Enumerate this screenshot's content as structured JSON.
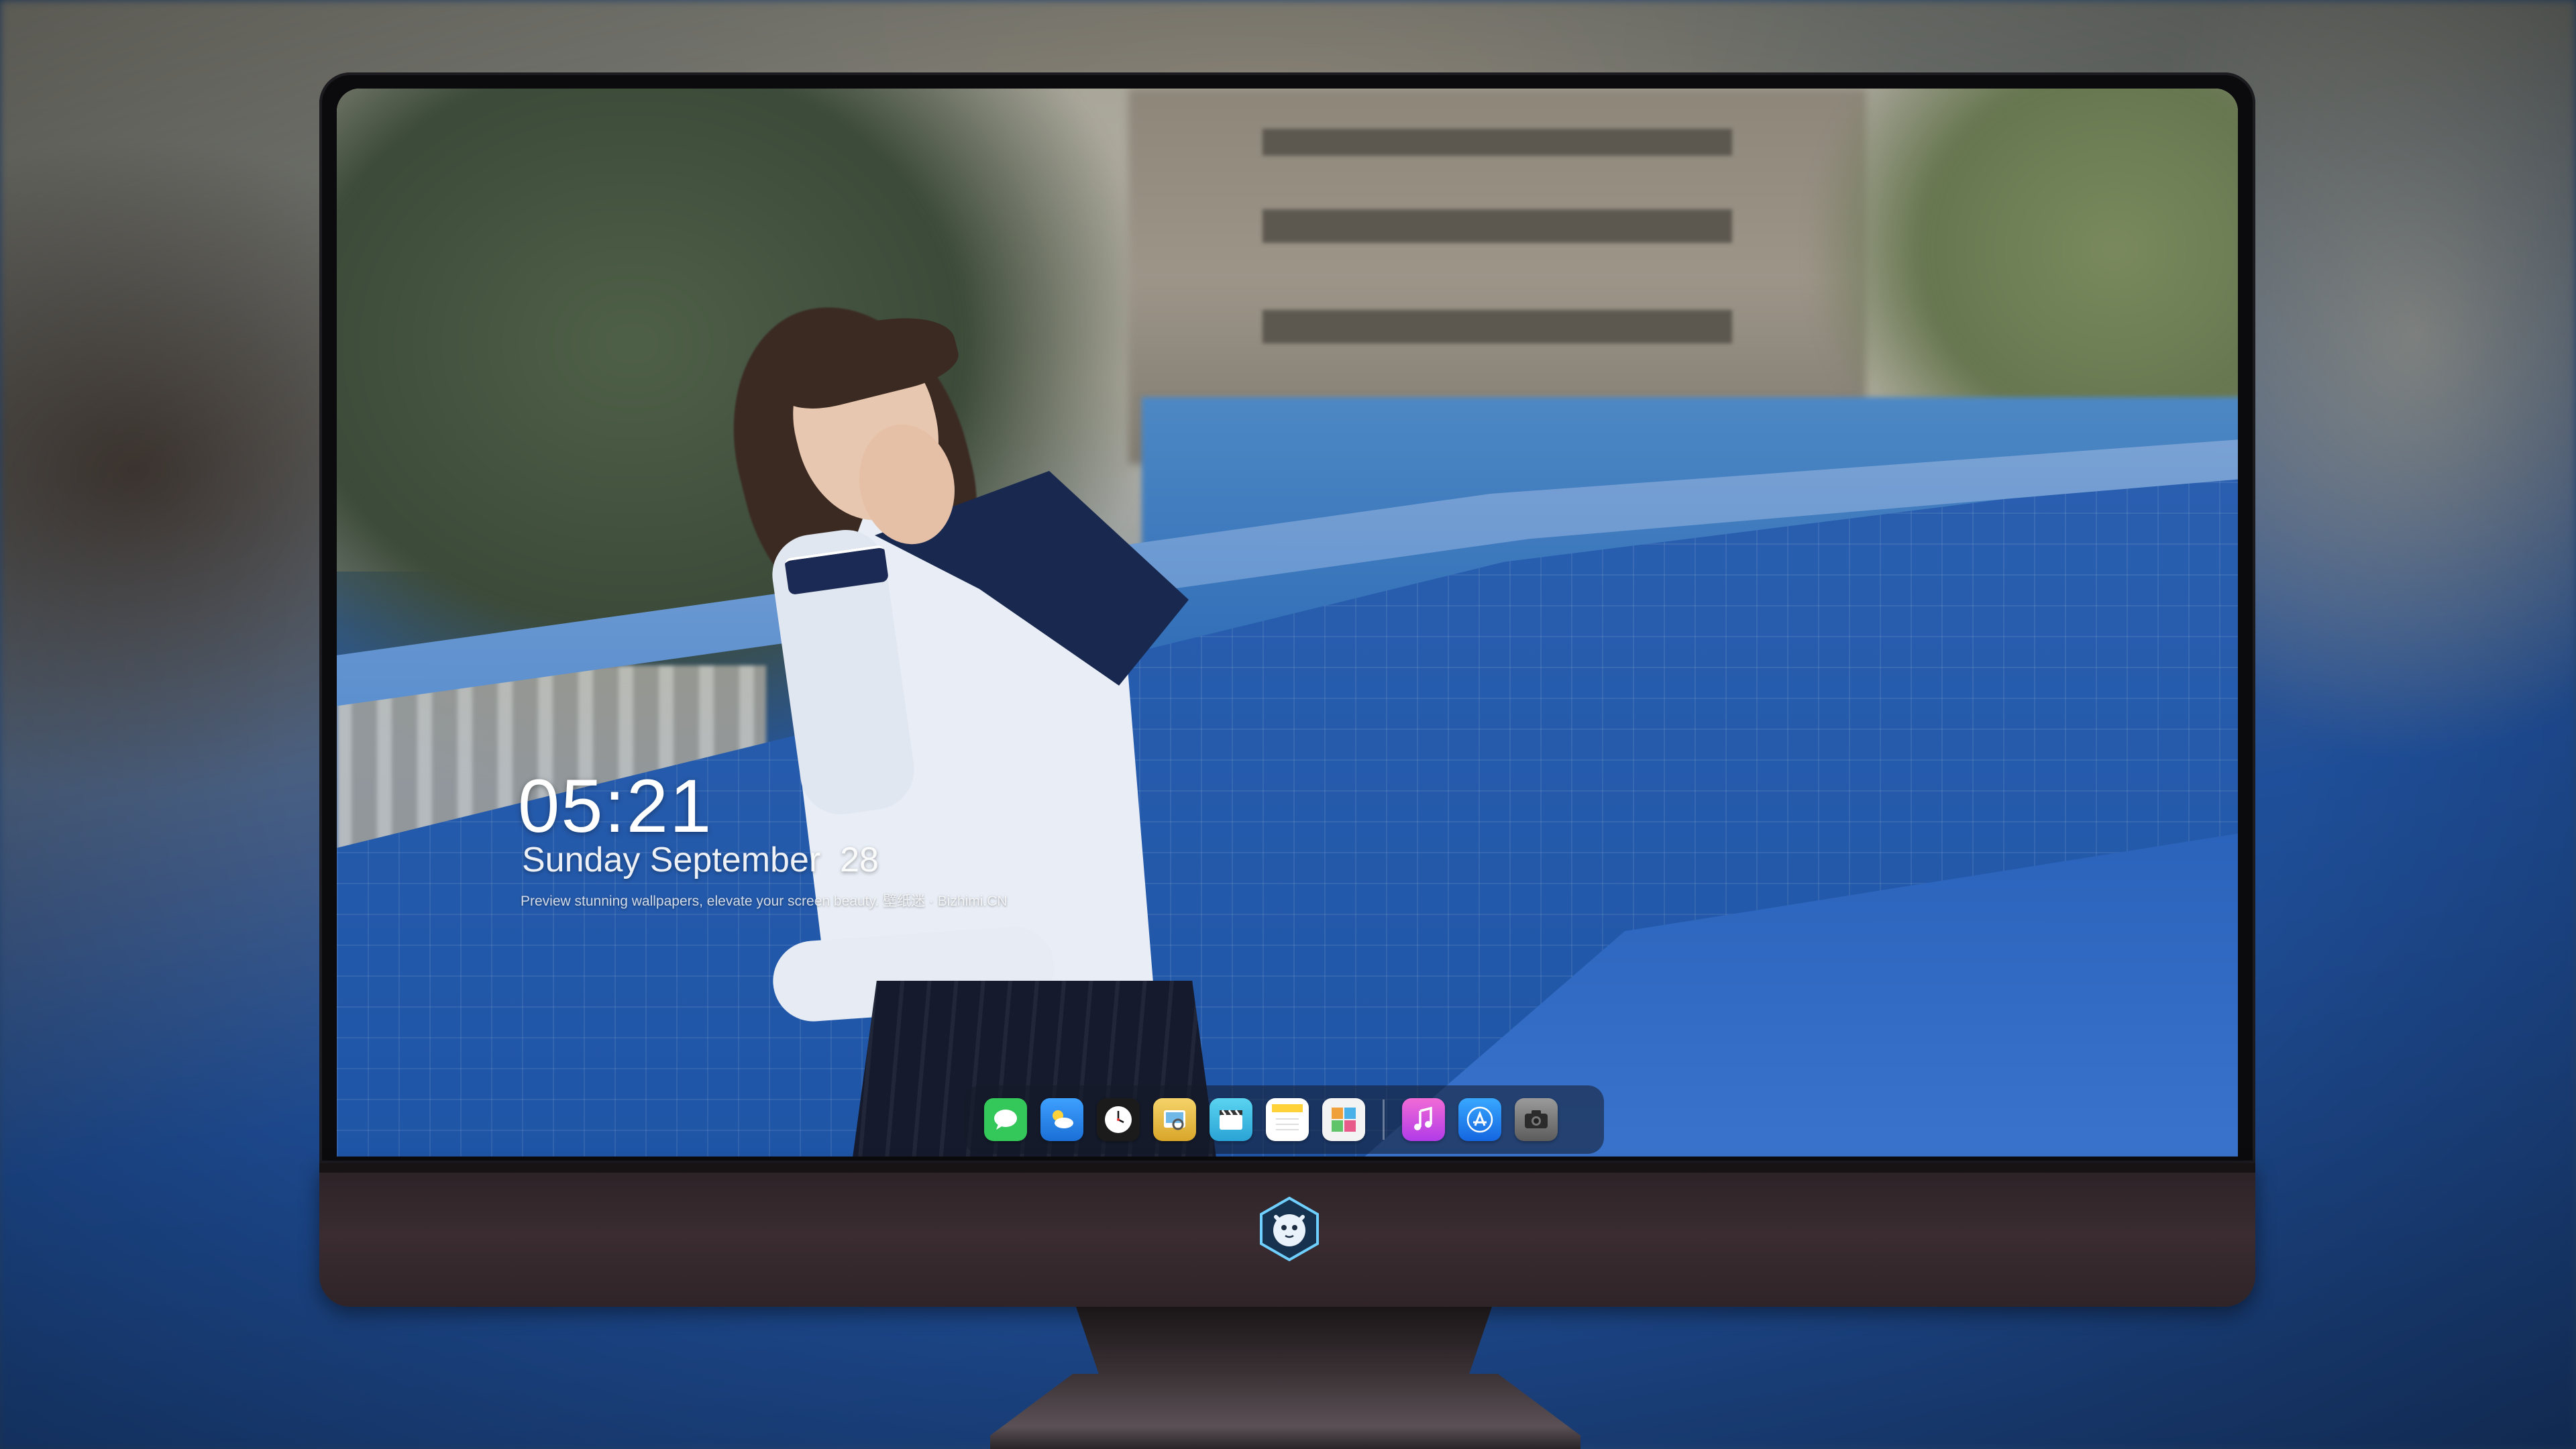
{
  "lockscreen": {
    "time": "05:21",
    "date": "Sunday September  28",
    "tagline": "Preview stunning wallpapers, elevate your screen beauty. 壁纸迷 · Bizhimi.CN"
  },
  "dock": {
    "apps": [
      {
        "icon": "messages-icon",
        "color": "#34c759"
      },
      {
        "icon": "weather-icon",
        "color": "#2f8cf0"
      },
      {
        "icon": "clock-icon",
        "color": "#ffffff"
      },
      {
        "icon": "preview-icon",
        "color": "#e9c24a"
      },
      {
        "icon": "video-icon",
        "color": "#3ec6e6"
      },
      {
        "icon": "notes-icon",
        "color": "#ffd84a"
      },
      {
        "icon": "photo-collage-icon",
        "color": "#f3f3f3"
      },
      {
        "icon": "music-icon",
        "color": "#d94cf0"
      },
      {
        "icon": "app-store-icon",
        "color": "#2f8cf0"
      },
      {
        "icon": "camera-icon",
        "color": "#8a8a8a"
      }
    ]
  },
  "monitor": {
    "logo_icon": "mascot-logo-icon"
  }
}
